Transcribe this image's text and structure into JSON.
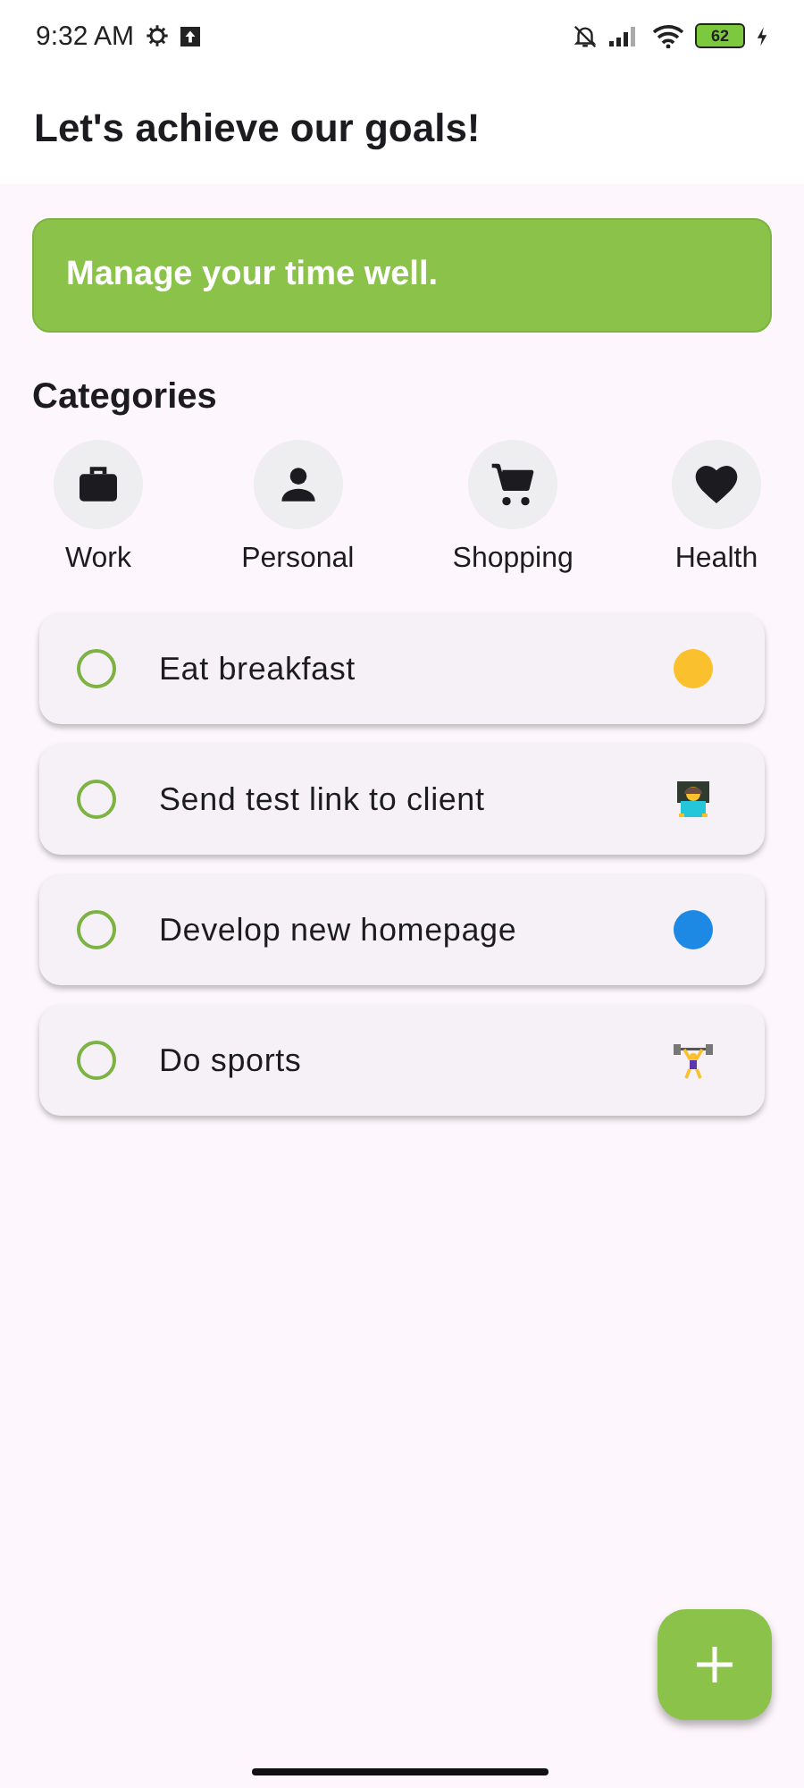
{
  "status_bar": {
    "time": "9:32 AM",
    "battery": "62"
  },
  "app_bar": {
    "title": "Let's achieve our goals!"
  },
  "banner": {
    "text": "Manage your time well."
  },
  "categories": {
    "title": "Categories",
    "items": [
      {
        "label": "Work",
        "kind": "briefcase"
      },
      {
        "label": "Personal",
        "kind": "person"
      },
      {
        "label": "Shopping",
        "kind": "cart"
      },
      {
        "label": "Health",
        "kind": "heart"
      }
    ]
  },
  "tasks": [
    {
      "title": "Eat breakfast",
      "done": false,
      "kind": "dot",
      "color": "#fbc02d"
    },
    {
      "title": "Send test link to client",
      "done": false,
      "kind": "laptop"
    },
    {
      "title": "Develop new homepage",
      "done": false,
      "kind": "dot",
      "color": "#1e88e5"
    },
    {
      "title": "Do sports",
      "done": false,
      "kind": "lifter"
    }
  ]
}
